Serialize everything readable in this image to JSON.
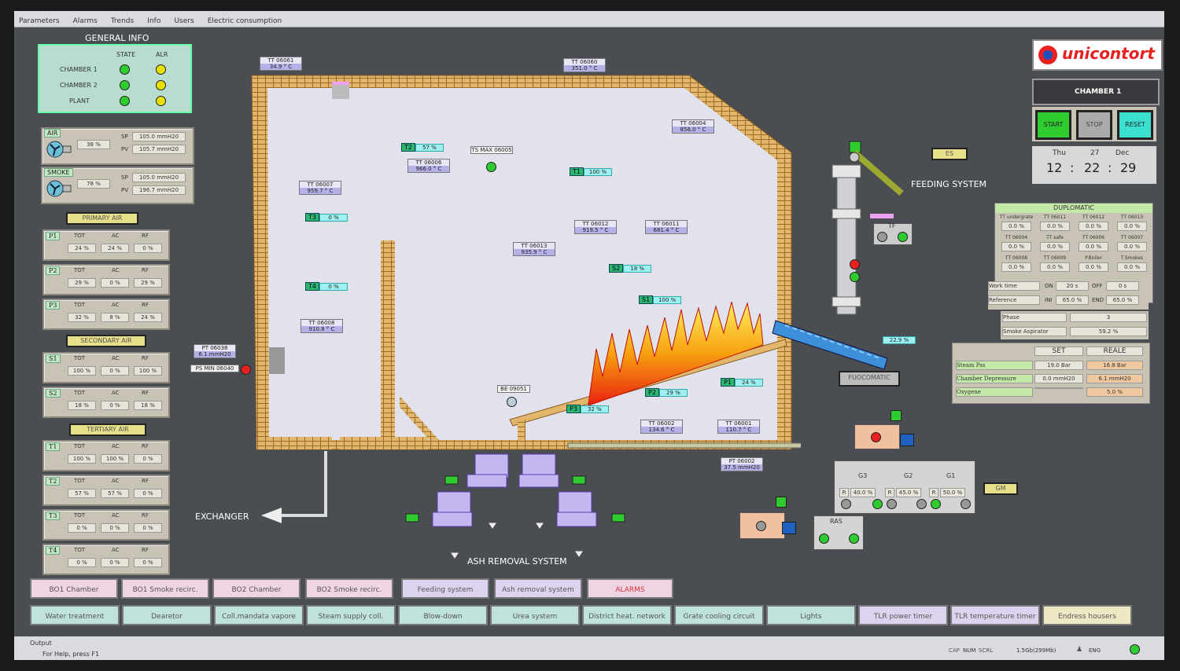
{
  "menu": [
    "Parameters",
    "Alarms",
    "Trends",
    "Info",
    "Users",
    "Electric consumption"
  ],
  "general_info": {
    "title": "GENERAL INFO",
    "col_state": "STATE",
    "col_alr": "ALR",
    "rows": [
      {
        "label": "CHAMBER 1",
        "state": "green",
        "alr": "yellow"
      },
      {
        "label": "CHAMBER 2",
        "state": "green",
        "alr": "yellow"
      },
      {
        "label": "PLANT",
        "state": "green",
        "alr": "yellow"
      }
    ]
  },
  "air": {
    "title": "AIR",
    "pct": "38 %",
    "sp_label": "SP",
    "pv_label": "PV",
    "sp": "105.0 mmH20",
    "pv": "105.7 mmH20"
  },
  "smoke": {
    "title": "SMOKE",
    "pct": "78 %",
    "sp_label": "SP",
    "pv_label": "PV",
    "sp": "105.0 mmH20",
    "pv": "196.7 mmH20"
  },
  "primary_air": {
    "title": "PRIMARY AIR",
    "rows": [
      {
        "name": "P1",
        "tot": "24 %",
        "ac": "24 %",
        "rf": "0 %"
      },
      {
        "name": "P2",
        "tot": "29 %",
        "ac": "0 %",
        "rf": "29 %"
      },
      {
        "name": "P3",
        "tot": "32 %",
        "ac": "8 %",
        "rf": "24 %"
      }
    ]
  },
  "secondary_air": {
    "title": "SECONDARY AIR",
    "rows": [
      {
        "name": "S1",
        "tot": "100 %",
        "ac": "0 %",
        "rf": "100 %"
      },
      {
        "name": "S2",
        "tot": "18 %",
        "ac": "0 %",
        "rf": "18 %"
      }
    ]
  },
  "tertiary_air": {
    "title": "TERTIARY AIR",
    "rows": [
      {
        "name": "T1",
        "tot": "100 %",
        "ac": "100 %",
        "rf": "0 %"
      },
      {
        "name": "T2",
        "tot": "57 %",
        "ac": "57 %",
        "rf": "0 %"
      },
      {
        "name": "T3",
        "tot": "0 %",
        "ac": "0 %",
        "rf": "0 %"
      },
      {
        "name": "T4",
        "tot": "0 %",
        "ac": "0 %",
        "rf": "0 %"
      }
    ]
  },
  "col_headers": {
    "tot": "TOT",
    "ac": "AC",
    "rf": "RF"
  },
  "chamber_tags": {
    "tt06061": {
      "name": "TT 06061",
      "val": "34.9 ° C"
    },
    "tt06060": {
      "name": "TT 06060",
      "val": "351.0 ° C"
    },
    "tt06004": {
      "name": "TT 06004",
      "val": "856.0 ° C"
    },
    "tt06007": {
      "name": "TT 06007",
      "val": "959.7 ° C"
    },
    "tt06006": {
      "name": "TT 06006",
      "val": "966.0 ° C"
    },
    "tt06012": {
      "name": "TT 06012",
      "val": "919.5 ° C"
    },
    "tt06011": {
      "name": "TT 06011",
      "val": "681.4 ° C"
    },
    "tt06013": {
      "name": "TT 06013",
      "val": "935.9 ° C"
    },
    "tt06008": {
      "name": "TT 06008",
      "val": "910.8 ° C"
    },
    "tt06002": {
      "name": "TT 06002",
      "val": "134.6 ° C"
    },
    "tt06001": {
      "name": "TT 06001",
      "val": "110.7 ° C"
    },
    "pt06038": {
      "name": "PT 06038",
      "val": "6.1 mmH20"
    },
    "psmin": "PS MIN 06040",
    "tsmax": "TS MAX 06005",
    "be": "BE 09051",
    "pt06002": {
      "name": "PT 06002",
      "val": "37.5 mmH20"
    },
    "t2": {
      "k": "T2",
      "p": "57 %"
    },
    "t1": {
      "k": "T1",
      "p": "100 %"
    },
    "t3": {
      "k": "T3",
      "p": "0 %"
    },
    "t4": {
      "k": "T4",
      "p": "0 %"
    },
    "s2": {
      "k": "S2",
      "p": "18 %"
    },
    "s1": {
      "k": "S1",
      "p": "100 %"
    },
    "p1": {
      "k": "P1",
      "p": "24 %"
    },
    "p2": {
      "k": "P2",
      "p": "29 %"
    },
    "p3": {
      "k": "P3",
      "p": "32 %"
    },
    "feed_pct": "22.9 %"
  },
  "labels": {
    "feeding": "FEEDING SYSTEM",
    "exchanger": "EXCHANGER",
    "ash": "ASH REMOVAL SYSTEM",
    "es": "ES",
    "tf": "TF",
    "fuocomatic": "FUOCOMATIC",
    "ras": "RAS",
    "gm": "GM"
  },
  "grate": {
    "g3": "G3",
    "g2": "G2",
    "g1": "G1",
    "r": "R",
    "v3": "40.0 %",
    "v2": "45.0 %",
    "v1": "50.0 %"
  },
  "brand": {
    "name": "unicontort"
  },
  "chamber_box": {
    "title": "CHAMBER 1",
    "start": "START",
    "stop": "STOP",
    "reset": "RESET",
    "day": "Thu",
    "date": "27",
    "month": "Dec",
    "hh": "12",
    "mm": "22",
    "ss": "29"
  },
  "duplomatic": {
    "title": "DUPLOMATIC",
    "grid": [
      {
        "h": "TT undergrate",
        "v": "0.0 %"
      },
      {
        "h": "TT 06011",
        "v": "0.0 %"
      },
      {
        "h": "TT 06012",
        "v": "0.0 %"
      },
      {
        "h": "TT 06013",
        "v": "0.0 %"
      },
      {
        "h": "TT 06004",
        "v": "0.0 %"
      },
      {
        "h": "TT safe",
        "v": "0.0 %"
      },
      {
        "h": "TT 06006",
        "v": "0.0 %"
      },
      {
        "h": "TT 06007",
        "v": "0.0 %"
      },
      {
        "h": "TT 06008",
        "v": "0.0 %"
      },
      {
        "h": "TT 06009",
        "v": "0.0 %"
      },
      {
        "h": "P.Boiler",
        "v": "0.0 %"
      },
      {
        "h": "T.Smokes",
        "v": "0.0 %"
      }
    ],
    "work_time": "Work time",
    "on": "ON",
    "on_v": "20 s",
    "off": "OFF",
    "off_v": "0 s",
    "reference": "Reference",
    "ini": "INI",
    "ini_v": "65.0 %",
    "end": "END",
    "end_v": "65.0 %",
    "phase": "Phase",
    "phase_v": "3",
    "aspirator": "Smoke Aspirator",
    "aspirator_v": "59.2 %"
  },
  "setpoints": {
    "set": "SET",
    "reale": "REALE",
    "rows": [
      {
        "name": "Steam Pss",
        "set": "19.0 Bar",
        "real": "16.8 Bar"
      },
      {
        "name": "Chamber Depressure",
        "set": "0.0 mmH20",
        "real": "6.1 mmH20"
      },
      {
        "name": "Oxygene",
        "set": "",
        "real": "5.0 %"
      }
    ]
  },
  "nav_row1": [
    "BO1 Chamber",
    "BO1 Smoke recirc.",
    "BO2 Chamber",
    "BO2 Smoke recirc.",
    "Feeding system",
    "Ash removal system",
    "ALARMS"
  ],
  "nav_row2": [
    "Water treatment",
    "Dearetor",
    "Coll.mandata vapore",
    "Steam supply coll.",
    "Blow-down",
    "Urea system",
    "District heat. network",
    "Grate cooling circuit",
    "Lights",
    "TLR power timer",
    "TLR temperature timer",
    "Endress housers"
  ],
  "status": {
    "output": "Output",
    "help": "For Help, press F1",
    "cap": "CAP",
    "num": "NUM",
    "scrl": "SCRL",
    "mem": "1.5Gb(299Mb)",
    "lang": "ENG"
  }
}
